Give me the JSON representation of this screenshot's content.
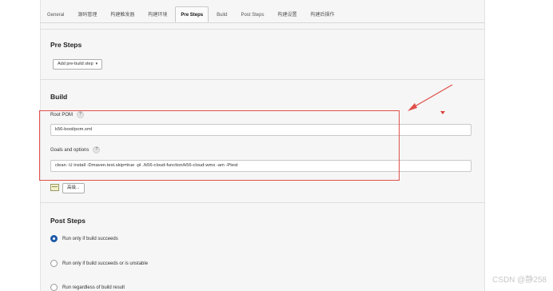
{
  "tabs": [
    {
      "label": "General",
      "active": false
    },
    {
      "label": "源码管理",
      "active": false
    },
    {
      "label": "构建触发器",
      "active": false
    },
    {
      "label": "构建环境",
      "active": false
    },
    {
      "label": "Pre Steps",
      "active": true
    },
    {
      "label": "Build",
      "active": false
    },
    {
      "label": "Post Steps",
      "active": false
    },
    {
      "label": "构建设置",
      "active": false
    },
    {
      "label": "构建后操作",
      "active": false
    }
  ],
  "pre_steps": {
    "title": "Pre Steps",
    "add_button": "Add pre-build step"
  },
  "build": {
    "title": "Build",
    "root_pom_label": "Root POM",
    "root_pom_value": "k56-boot/pom.xml",
    "goals_label": "Goals and options",
    "goals_value": "clean  -U install -Dmaven.test.skip=true -pl ./k56-cloud-function/k56-cloud-wms -am -Ptest",
    "advanced_button": "高级..."
  },
  "post_steps": {
    "title": "Post Steps",
    "options": [
      {
        "label": "Run only if build succeeds",
        "checked": true
      },
      {
        "label": "Run only if build succeeds or is unstable",
        "checked": false
      },
      {
        "label": "Run regardless of build result",
        "checked": false
      }
    ]
  },
  "watermark": "CSDN @静258",
  "colors": {
    "highlight": "#e0504a",
    "radio_selected": "#1e5aa8"
  },
  "icons": {
    "help": "?",
    "dropdown": "▾"
  }
}
